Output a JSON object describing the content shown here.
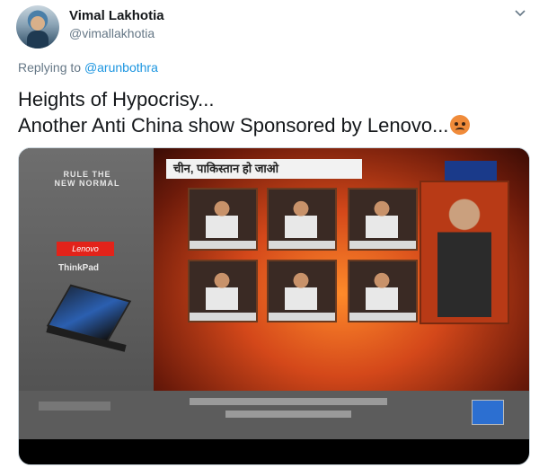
{
  "tweet": {
    "author_name": "Vimal Lakhotia",
    "author_handle": "@vimallakhotia",
    "reply_prefix": "Replying to",
    "reply_to": "@arunbothra",
    "text_line1": "Heights of Hypocrisy...",
    "text_line2": "Another Anti China show Sponsored by Lenovo...",
    "emoji_name": "angry-face-emoji"
  },
  "media": {
    "ad_slogan": "RULE THE NEW NORMAL",
    "ad_brand": "Lenovo",
    "ad_product": "ThinkPad",
    "headline": "चीन, पाकिस्तान हो जाओ"
  },
  "colors": {
    "link": "#1b95e0",
    "secondary_text": "#657786",
    "primary_text": "#14171a"
  }
}
